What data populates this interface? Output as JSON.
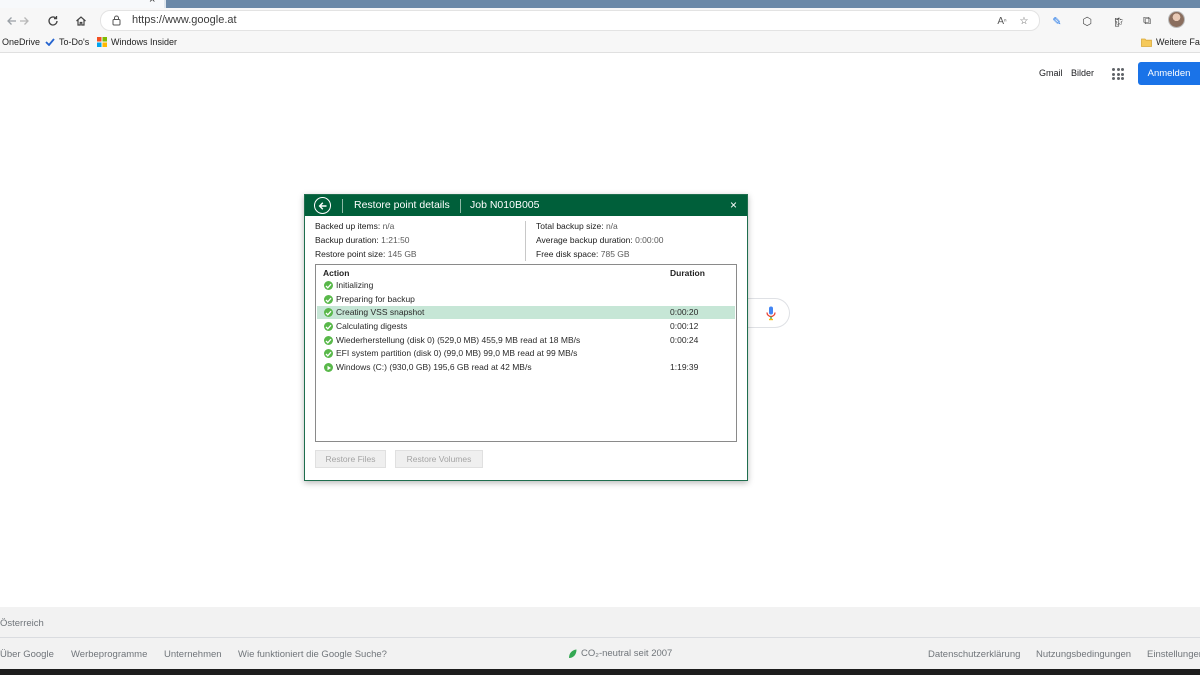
{
  "browser": {
    "tab_close": "×",
    "url": "https://www.google.at",
    "favorites": [
      "OneDrive",
      "To-Do's",
      "Windows Insider"
    ],
    "more_favorites": "Weitere Favo"
  },
  "google": {
    "top_links": [
      "Gmail",
      "Bilder"
    ],
    "signin_label": "Anmelden",
    "footer": {
      "country": "Österreich",
      "left_links": [
        "Über Google",
        "Werbeprogramme",
        "Unternehmen",
        "Wie funktioniert die Google Suche?"
      ],
      "center_text": "CO₂-neutral seit 2007",
      "right_links": [
        "Datenschutzerklärung",
        "Nutzungsbedingungen",
        "Einstellungen"
      ]
    }
  },
  "dialog": {
    "title": "Restore point details",
    "job": "Job N010B005",
    "close": "×",
    "stats_left": [
      {
        "label": "Backed up items:",
        "value": "n/a"
      },
      {
        "label": "Backup duration:",
        "value": "1:21:50"
      },
      {
        "label": "Restore point size:",
        "value": "145 GB"
      }
    ],
    "stats_right": [
      {
        "label": "Total backup size:",
        "value": "n/a"
      },
      {
        "label": "Average backup duration:",
        "value": "0:00:00"
      },
      {
        "label": "Free disk space:",
        "value": "785 GB"
      }
    ],
    "columns": {
      "action": "Action",
      "duration": "Duration"
    },
    "rows": [
      {
        "action": "Initializing",
        "duration": "",
        "status": "success"
      },
      {
        "action": "Preparing for backup",
        "duration": "",
        "status": "success"
      },
      {
        "action": "Creating VSS snapshot",
        "duration": "0:00:20",
        "status": "success",
        "selected": true
      },
      {
        "action": "Calculating digests",
        "duration": "0:00:12",
        "status": "success"
      },
      {
        "action": "Wiederherstellung (disk 0) (529,0 MB) 455,9 MB read at 18 MB/s",
        "duration": "0:00:24",
        "status": "success"
      },
      {
        "action": "EFI system partition (disk 0) (99,0 MB) 99,0 MB read at 99 MB/s",
        "duration": "",
        "status": "success"
      },
      {
        "action": "Windows (C:) (930,0 GB) 195,6 GB read at 42 MB/s",
        "duration": "1:19:39",
        "status": "running"
      }
    ],
    "buttons": {
      "restore_files": "Restore Files",
      "restore_volumes": "Restore Volumes"
    }
  },
  "colors": {
    "dialog_header": "#005f3a",
    "selected_row": "#c6e6d6",
    "status_success": "#59b84a",
    "google_blue": "#1a73e8"
  }
}
